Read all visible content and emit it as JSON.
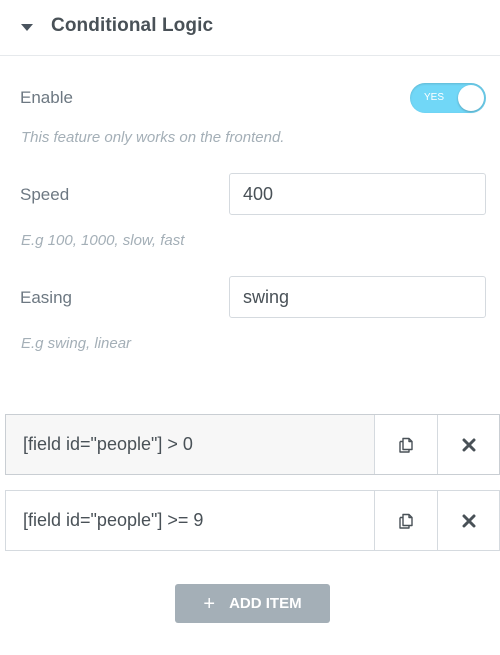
{
  "section": {
    "title": "Conditional Logic",
    "caret_icon": "caret-down-icon"
  },
  "enable": {
    "label": "Enable",
    "toggle_text": "YES",
    "toggle_on": true,
    "description": "This feature only works on the frontend."
  },
  "speed": {
    "label": "Speed",
    "value": "400",
    "description": "E.g 100, 1000, slow, fast"
  },
  "easing": {
    "label": "Easing",
    "value": "swing",
    "description": "E.g swing, linear"
  },
  "repeater": {
    "items": [
      {
        "title": "[field id=\"people\"] > 0"
      },
      {
        "title": "[field id=\"people\"] >= 9"
      }
    ],
    "duplicate_icon": "duplicate-icon",
    "remove_icon": "close-icon"
  },
  "add_item": {
    "label": "ADD ITEM",
    "icon": "plus-icon"
  },
  "colors": {
    "toggle_on": "#71d7f7",
    "add_button": "#a4afb7",
    "text": "#495157",
    "muted": "#a4afb7"
  }
}
